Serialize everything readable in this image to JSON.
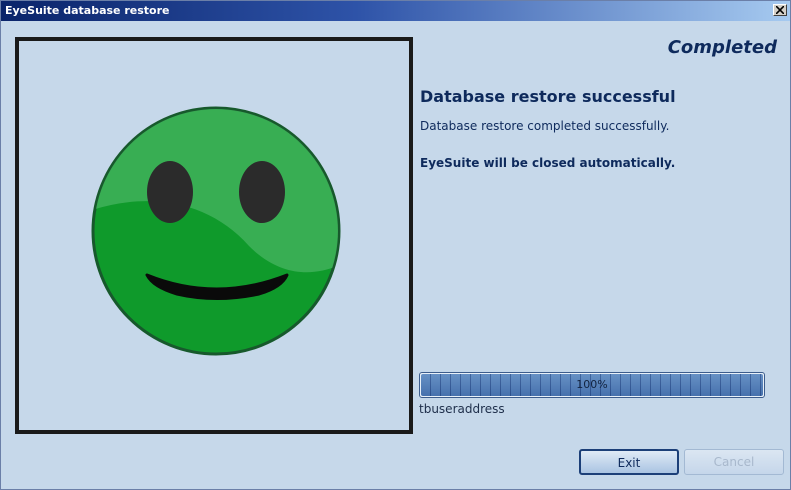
{
  "window": {
    "title": "EyeSuite database restore"
  },
  "status": {
    "heading": "Completed",
    "result_title": "Database restore successful",
    "result_detail": "Database restore completed successfully.",
    "close_note": "EyeSuite will be closed automatically."
  },
  "progress": {
    "value_percent": 100,
    "text": "100%",
    "task_label": "tbuseraddress"
  },
  "buttons": {
    "exit_label": "Exit",
    "cancel_label": "Cancel",
    "cancel_enabled": false
  },
  "image": {
    "icon": "green-smiley-face"
  },
  "colors": {
    "window_background": "#c6d8ea",
    "title_bar": "#0a246a",
    "smiley_green": "#11a02e",
    "text_dark_blue": "#0e2a5c"
  }
}
